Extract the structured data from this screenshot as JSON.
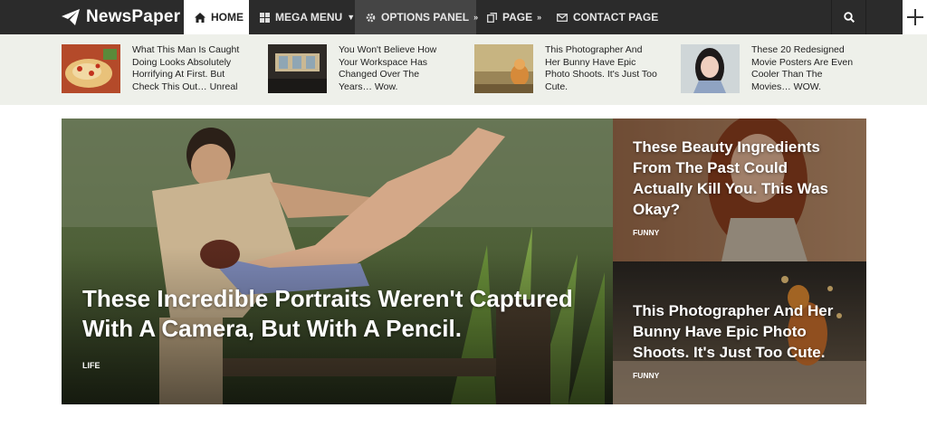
{
  "brand": {
    "name": "NewsPaper",
    "logo_icon": "paper-plane-icon"
  },
  "nav": {
    "home": "HOME",
    "mega_menu": "MEGA MENU",
    "options_panel": "OPTIONS PANEL",
    "page": "PAGE",
    "contact_page": "CONTACT PAGE"
  },
  "strip": [
    {
      "text": "What This Man Is Caught Doing Looks Absolutely Horrifying At First. But Check This Out… Unreal"
    },
    {
      "text": "You Won't Believe How Your Workspace Has Changed Over The Years… Wow."
    },
    {
      "text": "This Photographer And Her Bunny Have Epic Photo Shoots. It's Just Too Cute."
    },
    {
      "text": "These 20 Redesigned Movie Posters Are Even Cooler Than The Movies… WOW."
    }
  ],
  "hero": {
    "main": {
      "title": "These Incredible Portraits Weren't Captured With A Camera, But With A Pencil.",
      "category": "LIFE"
    },
    "side_top": {
      "title": "These Beauty Ingredients From The Past Could Actually Kill You. This Was Okay?",
      "category": "FUNNY"
    },
    "side_bottom": {
      "title": "This Photographer And Her Bunny Have Epic Photo Shoots. It's Just Too Cute.",
      "category": "FUNNY"
    }
  },
  "colors": {
    "navbar": "#2b2b2b",
    "active_tab": "#ffffff",
    "options_tab": "#454545",
    "strip_bg": "#eef0ea"
  }
}
